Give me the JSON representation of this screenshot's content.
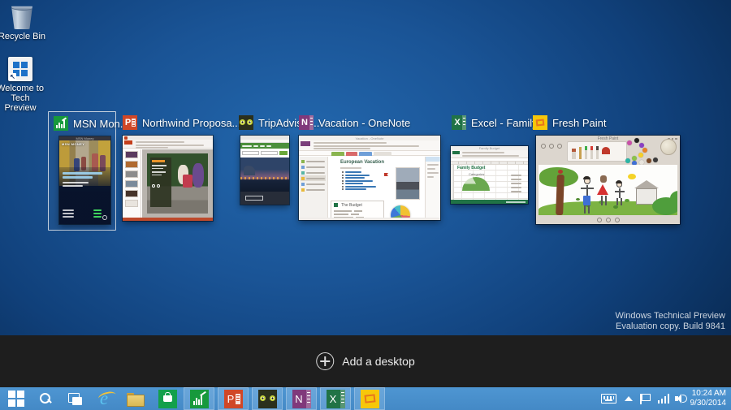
{
  "desktop": {
    "recycle_bin_label": "Recycle Bin",
    "welcome_label_line1": "Welcome to",
    "welcome_label_line2": "Tech Preview",
    "watermark": {
      "line1": "Windows Technical Preview",
      "line2": "Evaluation copy. Build 9841"
    }
  },
  "task_view": {
    "add_desktop_label": "Add a desktop",
    "windows": [
      {
        "title": "MSN Mon...",
        "app": "MSN Money",
        "selected": true
      },
      {
        "title": "Northwind Proposa...",
        "app": "PowerPoint",
        "selected": false
      },
      {
        "title": "TripAdvisor...",
        "app": "Internet Explorer",
        "selected": false
      },
      {
        "title": "Vacation - OneNote",
        "app": "OneNote",
        "selected": false
      },
      {
        "title": "Excel - Family...",
        "app": "Excel",
        "selected": false
      },
      {
        "title": "Fresh Paint",
        "app": "Fresh Paint",
        "selected": false
      }
    ]
  },
  "thumbnails": {
    "msn": {
      "masthead": "MSN MONEY",
      "window_title": "MSN Money"
    },
    "onenote": {
      "page_title": "European Vacation",
      "budget_title": "The Budget"
    },
    "excel": {
      "sheet_title": "Family Budget",
      "chart_title": "Categories"
    },
    "freshpaint": {
      "window_title": "Fresh Paint"
    }
  },
  "taskbar": {
    "tray": {
      "time": "10:24 AM",
      "date": "9/30/2014"
    }
  },
  "colors": {
    "taskbar": "#4489c6",
    "taskbar_tile_highlight": "#63a3d8",
    "strip": "#1e1e1e",
    "selection_border": "#c3cfdd",
    "desktop_center": "#2368ae",
    "desktop_edge": "#071f40"
  }
}
